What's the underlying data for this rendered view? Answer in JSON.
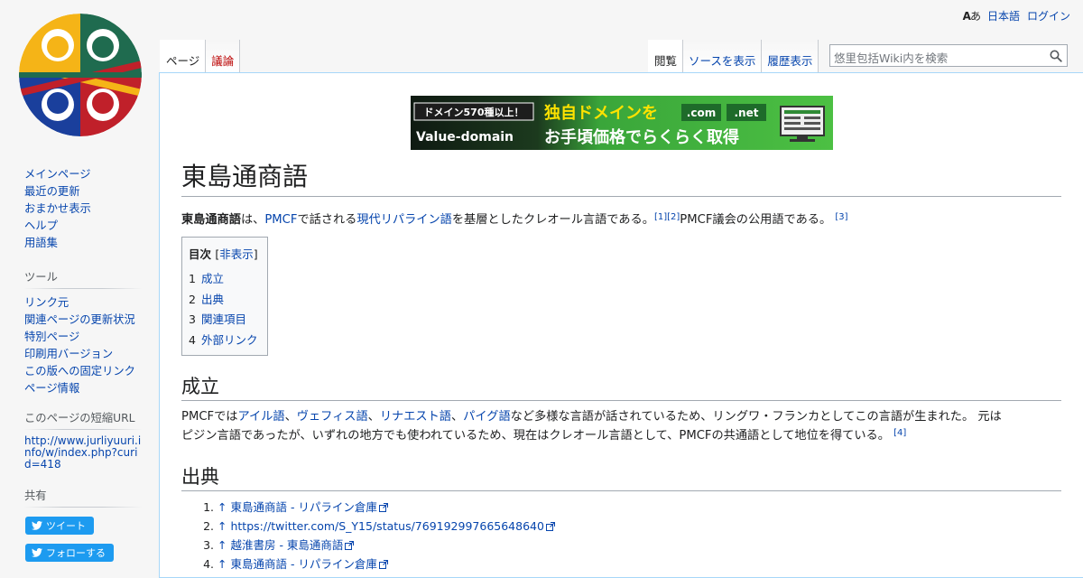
{
  "personal": {
    "language": "日本語",
    "login": "ログイン"
  },
  "tabs": {
    "left": [
      {
        "label": "ページ",
        "selected": true
      },
      {
        "label": "議論",
        "new": true
      }
    ],
    "right": [
      {
        "label": "閲覧",
        "selected": true
      },
      {
        "label": "ソースを表示"
      },
      {
        "label": "履歴表示"
      }
    ]
  },
  "search": {
    "placeholder": "悠里包括Wiki内を検索",
    "icon": "search-icon"
  },
  "banner": {
    "tag": "ドメイン570種以上！",
    "brand": "Value-domain",
    "line1": "独自ドメインを",
    "line2": "お手頃価格でらくらく取得",
    "tld1": ".com",
    "tld2": ".net"
  },
  "article": {
    "title": "東島通商語",
    "intro": {
      "bold": "東島通商語",
      "t1": "は、",
      "link1": "PMCF",
      "t2": "で話される",
      "link2": "現代リパライン語",
      "t3": "を基層としたクレオール言語である。",
      "ref1": "[1]",
      "ref2": "[2]",
      "t4": "PMCF議会の公用語である。",
      "ref3": "[3]"
    },
    "toc": {
      "title": "目次",
      "toggle": "非表示",
      "items": [
        {
          "num": "1",
          "label": "成立"
        },
        {
          "num": "2",
          "label": "出典"
        },
        {
          "num": "3",
          "label": "関連項目"
        },
        {
          "num": "4",
          "label": "外部リンク"
        }
      ]
    },
    "section1": {
      "heading": "成立",
      "t1": "PMCFでは",
      "l1": "アイル語",
      "s1": "、",
      "l2": "ヴェフィス語",
      "s2": "、",
      "l3": "リナエスト語",
      "s3": "、",
      "l4": "パイグ語",
      "t2": "など多様な言語が話されているため、リングワ・フランカとしてこの言語が生まれた。 元は",
      "t3": "ピジン言語であったが、いずれの地方でも使われているため、現在はクレオール言語として、PMCFの共通語として地位を得ている。",
      "ref": "[4]"
    },
    "section2": {
      "heading": "出典",
      "refs": [
        {
          "num": "1.",
          "arrow": "↑",
          "text": "東島通商語 - リパライン倉庫"
        },
        {
          "num": "2.",
          "arrow": "↑",
          "text": "https://twitter.com/S_Y15/status/769192997665648640"
        },
        {
          "num": "3.",
          "arrow": "↑",
          "text": "越淮書房 - 東島通商語"
        },
        {
          "num": "4.",
          "arrow": "↑",
          "text": "東島通商語 - リパライン倉庫"
        }
      ]
    }
  },
  "sidebar": {
    "navigation": [
      "メインページ",
      "最近の更新",
      "おまかせ表示",
      "ヘルプ",
      "用語集"
    ],
    "tools": {
      "heading": "ツール",
      "items": [
        "リンク元",
        "関連ページの更新状況",
        "特別ページ",
        "印刷用バージョン",
        "この版への固定リンク",
        "ページ情報"
      ]
    },
    "shorturl": {
      "heading": "このページの短縮URL",
      "url": "http://www.jurliyuuri.info/w/index.php?curid=418"
    },
    "share": {
      "heading": "共有",
      "tweet": "ツイート",
      "follow": "フォローする"
    }
  },
  "colors": {
    "link": "#0645ad",
    "new_link": "#ba0000",
    "twitter": "#1d9bf0",
    "border": "#a7d7f9"
  }
}
